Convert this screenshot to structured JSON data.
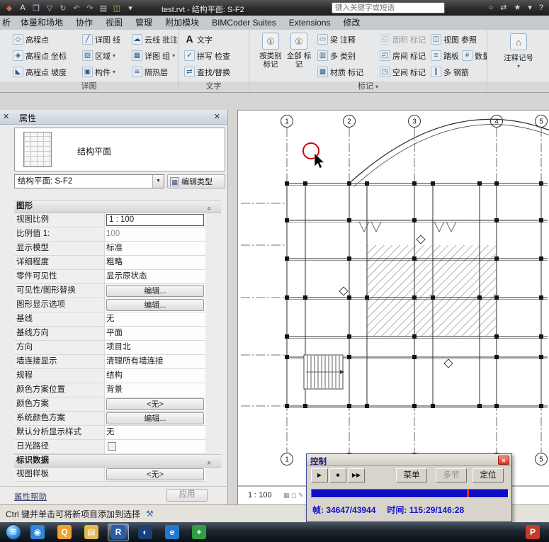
{
  "titlebar": {
    "title": "test.rvt - 结构平面: S-F2",
    "search_placeholder": "键入关键字或短语",
    "qat_icons": [
      {
        "name": "application-button-icon",
        "glyph": "◆",
        "color": "#c46a5a"
      },
      {
        "name": "font-style-icon",
        "glyph": "A",
        "color": "#f0f0f0"
      },
      {
        "name": "open-icon",
        "glyph": "❒",
        "color": "#a9c4dd"
      },
      {
        "name": "save-icon",
        "glyph": "▽",
        "color": "#a9c4dd"
      },
      {
        "name": "sync-icon",
        "glyph": "↻",
        "color": "#8fc491"
      },
      {
        "name": "undo-icon",
        "glyph": "↶",
        "color": "#7fb2e0"
      },
      {
        "name": "redo-icon",
        "glyph": "↷",
        "color": "#7fb2e0"
      },
      {
        "name": "print-icon",
        "glyph": "▤",
        "color": "#c9c9c9"
      },
      {
        "name": "measure-icon",
        "glyph": "◫",
        "color": "#d3b478"
      },
      {
        "name": "qat-menu-icon",
        "glyph": "▾",
        "color": "#cfcfcf"
      }
    ],
    "right_icons": [
      {
        "name": "search-icon",
        "glyph": "○",
        "color": "#d9d9d9"
      },
      {
        "name": "exchange-apps-icon",
        "glyph": "⇄",
        "color": "#d9d9d9"
      },
      {
        "name": "favorites-star-icon",
        "glyph": "★",
        "color": "#d9d9d9"
      },
      {
        "name": "infocenter-menu-icon",
        "glyph": "▾",
        "color": "#d9d9d9"
      },
      {
        "name": "help-icon",
        "glyph": "?",
        "color": "#d9d9d9"
      }
    ]
  },
  "ribbon": {
    "tabs": [
      "析",
      "体量和场地",
      "协作",
      "视图",
      "管理",
      "附加模块",
      "BIMCoder Suites",
      "Extensions",
      "修改"
    ],
    "caret_glyph": "▾",
    "detail_panel": {
      "label": "详图",
      "items": [
        {
          "label": "高程点",
          "icon": "spot-elevation-icon",
          "glyph": "◇"
        },
        {
          "label": "高程点 坐标",
          "icon": "spot-coordinate-icon",
          "glyph": "◈"
        },
        {
          "label": "高程点 坡度",
          "icon": "spot-slope-icon",
          "glyph": "◣"
        },
        {
          "label": "详图 线",
          "icon": "detail-line-icon",
          "glyph": "╱"
        },
        {
          "label": "区域",
          "icon": "filled-region-icon",
          "glyph": "▨"
        },
        {
          "label": "构件",
          "icon": "detail-component-icon",
          "glyph": "▣"
        },
        {
          "label": "云线 批注",
          "icon": "revision-cloud-icon",
          "glyph": "☁"
        },
        {
          "label": "详图 组",
          "icon": "detail-group-icon",
          "glyph": "▦"
        },
        {
          "label": "隔热层",
          "icon": "insulation-icon",
          "glyph": "≋"
        }
      ]
    },
    "text_panel": {
      "label": "文字",
      "items": [
        {
          "label": "文字",
          "icon": "text-icon",
          "glyph": "A"
        },
        {
          "label": "拼写 检查",
          "icon": "spelling-check-icon",
          "glyph": "✓"
        },
        {
          "label": "查找/替换",
          "icon": "find-replace-icon",
          "glyph": "⇄"
        }
      ]
    },
    "tag_panel": {
      "label": "标记",
      "big_items": [
        {
          "label": "按类别 标记",
          "icon": "tag-by-category-icon",
          "glyph": "①"
        },
        {
          "label": "全部 标记",
          "icon": "tag-all-icon",
          "glyph": "①"
        }
      ],
      "items": [
        {
          "label": "梁 注释",
          "icon": "beam-annotation-icon",
          "glyph": "▭"
        },
        {
          "label": "多 类别",
          "icon": "multi-category-tag-icon",
          "glyph": "▥"
        },
        {
          "label": "材质 标记",
          "icon": "material-tag-icon",
          "glyph": "▩"
        },
        {
          "label": "面积 标记",
          "icon": "area-tag-icon",
          "glyph": "◱"
        },
        {
          "label": "房间 标记",
          "icon": "room-tag-icon",
          "glyph": "◰"
        },
        {
          "label": "空间 标记",
          "icon": "space-tag-icon",
          "glyph": "◳"
        },
        {
          "label": "视图 参照",
          "icon": "view-reference-icon",
          "glyph": "◫"
        },
        {
          "label": "踏板",
          "icon": "tread-number-icon",
          "glyph": "≡"
        },
        {
          "label": "数量",
          "icon": "quantity-icon",
          "glyph": "#"
        },
        {
          "label": "多 钢筋",
          "icon": "multi-rebar-icon",
          "glyph": "∥"
        }
      ]
    },
    "keynote_panel": {
      "label": "注释记号",
      "icon": "keynote-icon",
      "glyph": "⌂"
    }
  },
  "properties": {
    "panel_title": "属性",
    "type_label": "结构平面",
    "selector_value": "结构平面: S-F2",
    "caret_glyph": "▼",
    "collapse_glyph": "«",
    "edit_type_label": "编辑类型",
    "edit_type_glyph": "▦",
    "section_graphics": "图形",
    "section_identity": "标识数据",
    "rows": [
      {
        "label": "视图比例",
        "value": "1 : 100"
      },
      {
        "label": "比例值 1:",
        "value": "100"
      },
      {
        "label": "显示模型",
        "value": "标准"
      },
      {
        "label": "详细程度",
        "value": "粗略"
      },
      {
        "label": "零件可见性",
        "value": "显示原状态"
      },
      {
        "label": "可见性/图形替换",
        "value": "编辑..."
      },
      {
        "label": "图形显示选项",
        "value": "编辑..."
      },
      {
        "label": "基线",
        "value": "无"
      },
      {
        "label": "基线方向",
        "value": "平面"
      },
      {
        "label": "方向",
        "value": "项目北"
      },
      {
        "label": "墙连接显示",
        "value": "清理所有墙连接"
      },
      {
        "label": "规程",
        "value": "结构"
      },
      {
        "label": "颜色方案位置",
        "value": "背景"
      },
      {
        "label": "颜色方案",
        "value": "<无>"
      },
      {
        "label": "系统颜色方案",
        "value": "编辑..."
      },
      {
        "label": "默认分析显示样式",
        "value": "无"
      },
      {
        "label": "日光路径",
        "value": ""
      },
      {
        "label": "视图样板",
        "value": "<无>"
      }
    ],
    "help_link": "属性帮助",
    "apply_button": "应用"
  },
  "canvas": {
    "grid_bubbles": [
      "1",
      "2",
      "3",
      "4",
      "5"
    ],
    "scale_label": "1 : 100",
    "view_control_icons": "▦ ◻ ✎",
    "annotation_color": "#d40000"
  },
  "control_dialog": {
    "title": "控制",
    "close_glyph": "×",
    "play_icon": "▶",
    "stop_icon": "■",
    "forward_icon": "▶▶",
    "menu_button": "菜单",
    "multi_button": "多节",
    "locate_button": "定位",
    "frame_text": "帧: 34647/43944",
    "time_text": "时间: 115:29/146:28",
    "progress_percent": 79,
    "progress_color": "#0d0dc4",
    "marker_color": "#ff2a1a"
  },
  "statusbar": {
    "hint": "Ctrl 键并单击可将新项目添加到选择",
    "icon_glyph": "⚒"
  },
  "taskbar": {
    "start_glyph": "⊞",
    "items": [
      {
        "name": "app-blue-swirl",
        "glyph": "◉",
        "bg": "#2f86d6"
      },
      {
        "name": "qq",
        "glyph": "Q",
        "bg": "#f0a030"
      },
      {
        "name": "folder-explorer",
        "glyph": "▤",
        "bg": "#e3b84e"
      },
      {
        "name": "revit",
        "glyph": "R",
        "bg": "#2a5caa",
        "active": true
      },
      {
        "name": "app-navy",
        "glyph": "◐",
        "bg": "#1b3f77"
      },
      {
        "name": "ie-browser",
        "glyph": "e",
        "bg": "#1f7ad4"
      },
      {
        "name": "app-green",
        "glyph": "+",
        "bg": "#2f9e44"
      },
      {
        "name": "powerpoint",
        "glyph": "P",
        "bg": "#c43b2e",
        "right": true
      }
    ]
  }
}
